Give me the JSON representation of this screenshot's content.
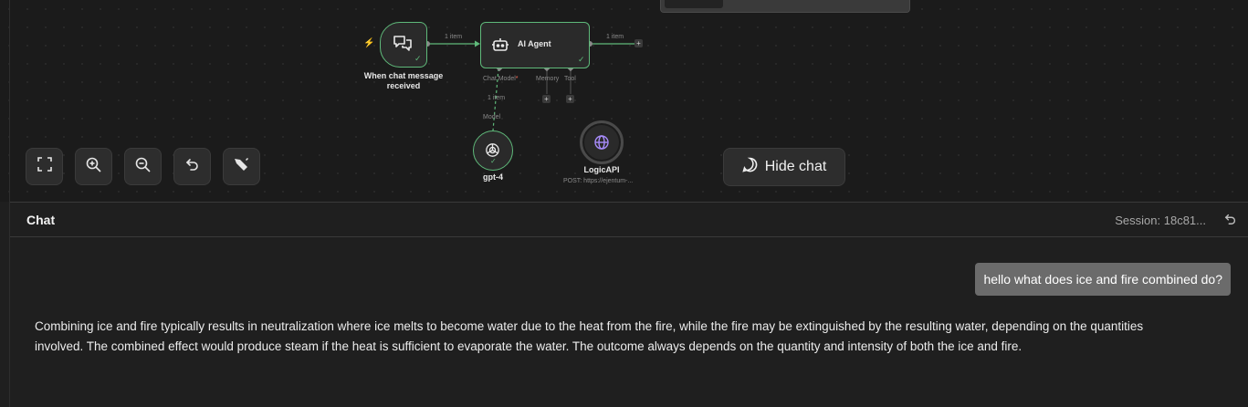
{
  "canvas": {
    "trigger_node": {
      "label": "When chat message received",
      "output_count": "1 item"
    },
    "agent_node": {
      "label": "AI Agent",
      "output_count": "1 item",
      "ports": {
        "chat_model": "Chat Model",
        "memory": "Memory",
        "tool": "Tool"
      }
    },
    "model_connection": {
      "count": "1 item",
      "label": "Model"
    },
    "model_node": {
      "label": "gpt-4",
      "icon": "openai-icon"
    },
    "tool_node": {
      "label": "LogicAPI",
      "subtitle": "POST: https://ejentum-...",
      "icon": "globe-icon"
    },
    "controls": {
      "fit_view": "fullscreen-icon",
      "zoom_in": "zoom-in-icon",
      "zoom_out": "zoom-out-icon",
      "undo": "undo-icon",
      "tidy": "broom-icon"
    },
    "hide_chat_label": "Hide chat",
    "colors": {
      "success": "#5fb97a",
      "trigger_bolt": "#ff6d5a",
      "required": "#ff6d5a"
    }
  },
  "chat": {
    "title": "Chat",
    "session": "Session: 18c81...",
    "messages": [
      {
        "role": "user",
        "text": "hello what does ice and fire combined do?"
      },
      {
        "role": "assistant",
        "text": "Combining ice and fire typically results in neutralization where ice melts to become water due to the heat from the fire, while the fire may be extinguished by the resulting water, depending on the quantities involved. The combined effect would produce steam if the heat is sufficient to evaporate the water. The outcome always depends on the quantity and intensity of both the ice and fire."
      }
    ]
  }
}
